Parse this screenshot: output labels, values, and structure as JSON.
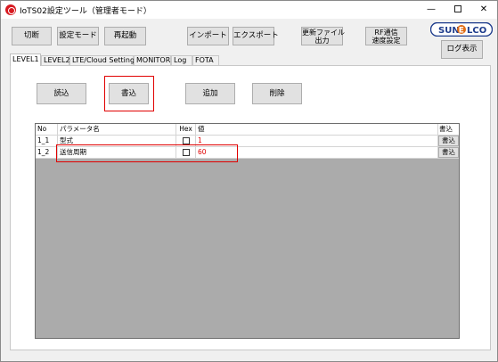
{
  "window": {
    "title": "IoTS02設定ツール（管理者モード）",
    "controls": {
      "minimize": "—",
      "close": "✕"
    }
  },
  "toolbar": {
    "disconnect": "切断",
    "config_mode": "設定モード",
    "restart": "再起動",
    "import": "インポート",
    "export": "エクスポート",
    "update_file_line1": "更新ファイル",
    "update_file_line2": "出力",
    "rf_line1": "RF通信",
    "rf_line2": "速度設定",
    "log_display": "ログ表示"
  },
  "logo": {
    "text_left": "SUN",
    "text_mid": "E",
    "text_right": "LCO"
  },
  "tabs": [
    "LEVEL1",
    "LEVEL2",
    "LTE/Cloud Settings",
    "MONITOR",
    "Log",
    "FOTA"
  ],
  "active_tab": "LEVEL1",
  "panel_buttons": {
    "read": "読込",
    "write": "書込",
    "add": "追加",
    "delete": "削除"
  },
  "grid": {
    "headers": {
      "no": "No",
      "name": "パラメータ名",
      "hex": "Hex",
      "value": "値",
      "write": "書込"
    },
    "rows": [
      {
        "no": "1_1",
        "name": "型式",
        "value": "1",
        "write": "書込"
      },
      {
        "no": "1_2",
        "name": "送信周期",
        "value": "60",
        "write": "書込"
      }
    ]
  },
  "colors": {
    "highlight": "#e00000",
    "logo_blue": "#1e3c8c",
    "logo_orange": "#e06a12",
    "icon_red": "#d71920"
  }
}
